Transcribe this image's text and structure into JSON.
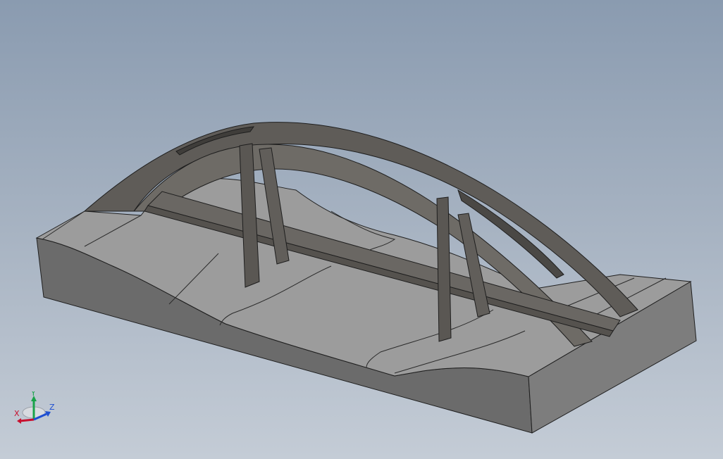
{
  "viewport": {
    "background_top": "#8a9bb0",
    "background_bottom": "#c4ccd6"
  },
  "model": {
    "description_icon": "bridge-model",
    "colors": {
      "ground_top": "#9c9c9c",
      "ground_front": "#6b6b6b",
      "ground_side": "#7d7d7d",
      "arch": "#5f5c58",
      "arch_light": "#6e6b66",
      "deck": "#6a6763",
      "edge": "#1e1e1e"
    }
  },
  "triad": {
    "x_label": "X",
    "y_label": "Y",
    "z_label": "Z",
    "x_color": "#c8102e",
    "y_color": "#19a34a",
    "z_color": "#1f4fd1"
  }
}
